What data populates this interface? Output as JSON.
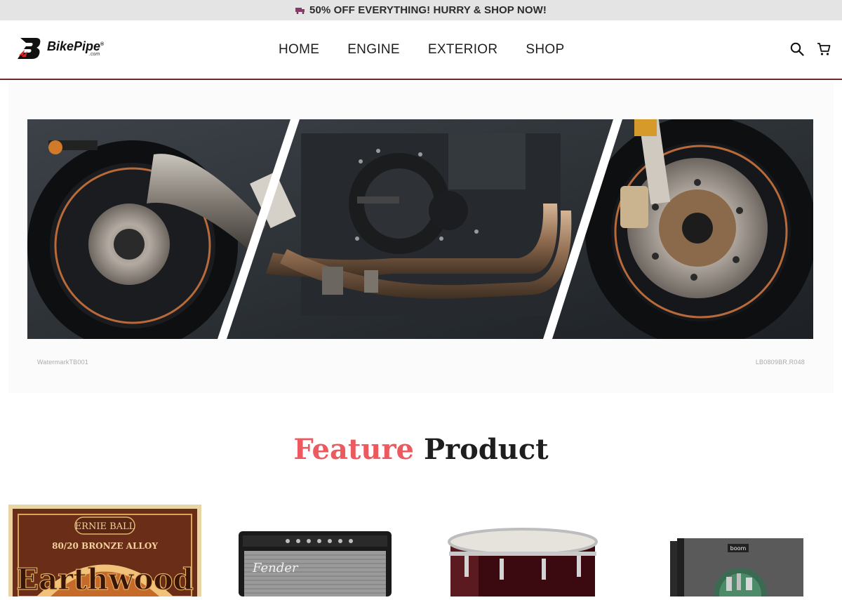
{
  "promo": {
    "text": "50% OFF EVERYTHING! HURRY & SHOP NOW!",
    "icon": "truck-icon"
  },
  "brand": {
    "name": "BikePipe",
    "sub": ".com",
    "mark": "®"
  },
  "nav": {
    "items": [
      {
        "label": "HOME"
      },
      {
        "label": "ENGINE"
      },
      {
        "label": "EXTERIOR"
      },
      {
        "label": "SHOP"
      }
    ]
  },
  "header_icons": [
    "search-icon",
    "cart-icon"
  ],
  "hero": {
    "caption_left": "WatermarkTB001",
    "caption_right": "LB0809BR.R048"
  },
  "feature": {
    "accent": "Feature",
    "rest": "Product"
  },
  "products": [
    {
      "name": "ERNIE BALL Earthwood 80/20 Bronze Alloy strings",
      "brand": "ERNIE BALL",
      "line": "80/20 BRONZE ALLOY",
      "title": "Earthwood"
    },
    {
      "name": "Fender guitar amplifier",
      "brand": "Fender"
    },
    {
      "name": "Red tom drum"
    },
    {
      "name": "Sample library box",
      "brand": "boom"
    }
  ],
  "colors": {
    "accent": "#ec5a5f",
    "header_border": "#6b2b2b",
    "promo_bg": "#e4e4e4"
  }
}
